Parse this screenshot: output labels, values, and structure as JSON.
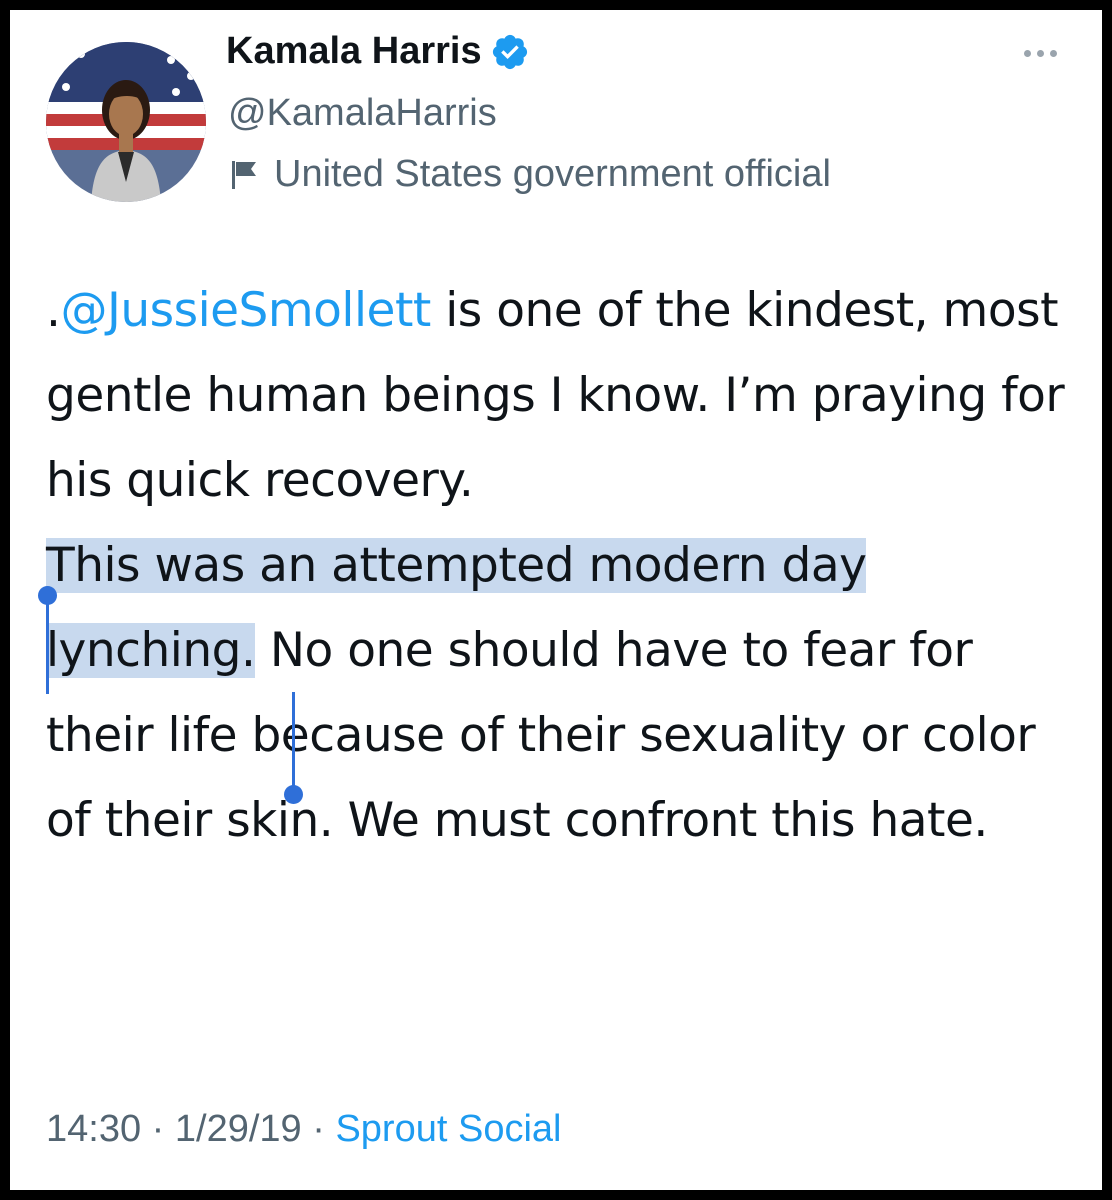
{
  "author": {
    "name": "Kamala Harris",
    "handle": "@KamalaHarris",
    "label": "United States government official",
    "verified_icon": "verified-badge-icon",
    "label_icon": "flag-icon"
  },
  "tweet": {
    "prefix": ".",
    "mention": "@JussieSmollett",
    "para1_rest": " is one of the kindest, most gentle human beings I know. I’m praying for his quick recovery.",
    "para2_selected": "This was an attempted modern day lynching.",
    "para2_rest": " No one should have to fear for their life because of their sexuality or color of their skin. We must confront this hate."
  },
  "meta": {
    "time": "14:30",
    "separator": " · ",
    "date": "1/29/19",
    "source": "Sprout Social"
  },
  "colors": {
    "link": "#1d9bf0",
    "text": "#0f1419",
    "muted": "#536471",
    "selection": "#c8d9ee",
    "selection_handle": "#2f6fd8"
  }
}
